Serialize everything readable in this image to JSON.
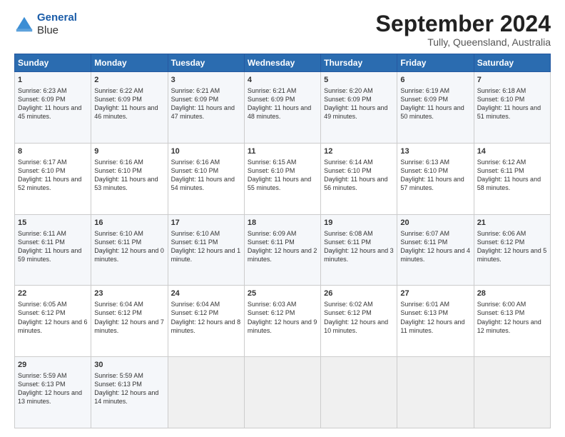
{
  "logo": {
    "line1": "General",
    "line2": "Blue"
  },
  "header": {
    "month": "September 2024",
    "location": "Tully, Queensland, Australia"
  },
  "weekdays": [
    "Sunday",
    "Monday",
    "Tuesday",
    "Wednesday",
    "Thursday",
    "Friday",
    "Saturday"
  ],
  "weeks": [
    [
      {
        "day": "1",
        "rise": "6:23 AM",
        "set": "6:09 PM",
        "hours": "11 hours and 45 minutes."
      },
      {
        "day": "2",
        "rise": "6:22 AM",
        "set": "6:09 PM",
        "hours": "11 hours and 46 minutes."
      },
      {
        "day": "3",
        "rise": "6:21 AM",
        "set": "6:09 PM",
        "hours": "11 hours and 47 minutes."
      },
      {
        "day": "4",
        "rise": "6:21 AM",
        "set": "6:09 PM",
        "hours": "11 hours and 48 minutes."
      },
      {
        "day": "5",
        "rise": "6:20 AM",
        "set": "6:09 PM",
        "hours": "11 hours and 49 minutes."
      },
      {
        "day": "6",
        "rise": "6:19 AM",
        "set": "6:09 PM",
        "hours": "11 hours and 50 minutes."
      },
      {
        "day": "7",
        "rise": "6:18 AM",
        "set": "6:10 PM",
        "hours": "11 hours and 51 minutes."
      }
    ],
    [
      {
        "day": "8",
        "rise": "6:17 AM",
        "set": "6:10 PM",
        "hours": "11 hours and 52 minutes."
      },
      {
        "day": "9",
        "rise": "6:16 AM",
        "set": "6:10 PM",
        "hours": "11 hours and 53 minutes."
      },
      {
        "day": "10",
        "rise": "6:16 AM",
        "set": "6:10 PM",
        "hours": "11 hours and 54 minutes."
      },
      {
        "day": "11",
        "rise": "6:15 AM",
        "set": "6:10 PM",
        "hours": "11 hours and 55 minutes."
      },
      {
        "day": "12",
        "rise": "6:14 AM",
        "set": "6:10 PM",
        "hours": "11 hours and 56 minutes."
      },
      {
        "day": "13",
        "rise": "6:13 AM",
        "set": "6:10 PM",
        "hours": "11 hours and 57 minutes."
      },
      {
        "day": "14",
        "rise": "6:12 AM",
        "set": "6:11 PM",
        "hours": "11 hours and 58 minutes."
      }
    ],
    [
      {
        "day": "15",
        "rise": "6:11 AM",
        "set": "6:11 PM",
        "hours": "11 hours and 59 minutes."
      },
      {
        "day": "16",
        "rise": "6:10 AM",
        "set": "6:11 PM",
        "hours": "12 hours and 0 minutes."
      },
      {
        "day": "17",
        "rise": "6:10 AM",
        "set": "6:11 PM",
        "hours": "12 hours and 1 minute."
      },
      {
        "day": "18",
        "rise": "6:09 AM",
        "set": "6:11 PM",
        "hours": "12 hours and 2 minutes."
      },
      {
        "day": "19",
        "rise": "6:08 AM",
        "set": "6:11 PM",
        "hours": "12 hours and 3 minutes."
      },
      {
        "day": "20",
        "rise": "6:07 AM",
        "set": "6:11 PM",
        "hours": "12 hours and 4 minutes."
      },
      {
        "day": "21",
        "rise": "6:06 AM",
        "set": "6:12 PM",
        "hours": "12 hours and 5 minutes."
      }
    ],
    [
      {
        "day": "22",
        "rise": "6:05 AM",
        "set": "6:12 PM",
        "hours": "12 hours and 6 minutes."
      },
      {
        "day": "23",
        "rise": "6:04 AM",
        "set": "6:12 PM",
        "hours": "12 hours and 7 minutes."
      },
      {
        "day": "24",
        "rise": "6:04 AM",
        "set": "6:12 PM",
        "hours": "12 hours and 8 minutes."
      },
      {
        "day": "25",
        "rise": "6:03 AM",
        "set": "6:12 PM",
        "hours": "12 hours and 9 minutes."
      },
      {
        "day": "26",
        "rise": "6:02 AM",
        "set": "6:12 PM",
        "hours": "12 hours and 10 minutes."
      },
      {
        "day": "27",
        "rise": "6:01 AM",
        "set": "6:13 PM",
        "hours": "12 hours and 11 minutes."
      },
      {
        "day": "28",
        "rise": "6:00 AM",
        "set": "6:13 PM",
        "hours": "12 hours and 12 minutes."
      }
    ],
    [
      {
        "day": "29",
        "rise": "5:59 AM",
        "set": "6:13 PM",
        "hours": "12 hours and 13 minutes."
      },
      {
        "day": "30",
        "rise": "5:59 AM",
        "set": "6:13 PM",
        "hours": "12 hours and 14 minutes."
      },
      null,
      null,
      null,
      null,
      null
    ]
  ]
}
